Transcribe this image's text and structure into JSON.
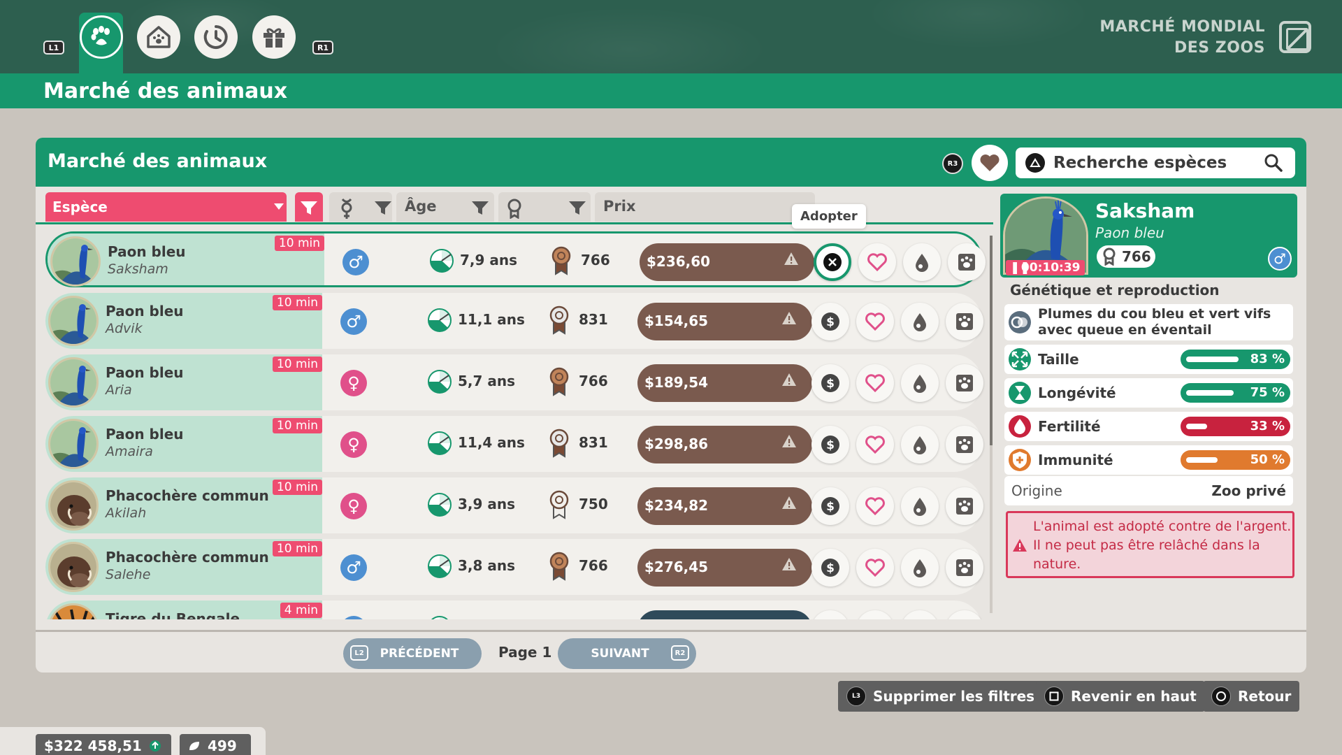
{
  "header": {
    "shoulder_left": "L1",
    "shoulder_right": "R1",
    "brand_line1": "MARCHÉ MONDIAL",
    "brand_line2": "DES ZOOS",
    "page_title": "Marché des animaux"
  },
  "nav_tabs": [
    {
      "icon": "paw-icon",
      "active": true
    },
    {
      "icon": "animal-house-icon",
      "active": false
    },
    {
      "icon": "clock-icon",
      "active": false
    },
    {
      "icon": "gift-icon",
      "active": false
    }
  ],
  "panel": {
    "title": "Marché des animaux",
    "r3_label": "R3",
    "search_placeholder": "Recherche espèces"
  },
  "columns": {
    "species": "Espèce",
    "age": "Âge",
    "price": "Prix"
  },
  "tooltip": "Adopter",
  "rows": [
    {
      "species": "Paon bleu",
      "name": "Saksham",
      "timer": "10 min",
      "sex": "m",
      "sex_symbol": "♂",
      "age": "7,9 ans",
      "rep": "766",
      "price": "$236,60",
      "selected": true
    },
    {
      "species": "Paon bleu",
      "name": "Advik",
      "timer": "10 min",
      "sex": "m",
      "sex_symbol": "♂",
      "age": "11,1 ans",
      "rep": "831",
      "price": "$154,65",
      "selected": false
    },
    {
      "species": "Paon bleu",
      "name": "Aria",
      "timer": "10 min",
      "sex": "f",
      "sex_symbol": "♀",
      "age": "5,7 ans",
      "rep": "766",
      "price": "$189,54",
      "selected": false
    },
    {
      "species": "Paon bleu",
      "name": "Amaira",
      "timer": "10 min",
      "sex": "f",
      "sex_symbol": "♀",
      "age": "11,4 ans",
      "rep": "831",
      "price": "$298,86",
      "selected": false
    },
    {
      "species": "Phacochère commun",
      "name": "Akilah",
      "timer": "10 min",
      "sex": "f",
      "sex_symbol": "♀",
      "age": "3,9 ans",
      "rep": "750",
      "price": "$234,82",
      "selected": false
    },
    {
      "species": "Phacochère commun",
      "name": "Salehe",
      "timer": "10 min",
      "sex": "m",
      "sex_symbol": "♂",
      "age": "3,8 ans",
      "rep": "766",
      "price": "$276,45",
      "selected": false
    },
    {
      "species": "Tigre du Bengale",
      "name": "",
      "timer": "4 min",
      "sex": "m",
      "sex_symbol": "♂",
      "age": "",
      "rep": "",
      "price": "",
      "selected": false
    }
  ],
  "pagination": {
    "prev_pad": "L2",
    "prev_label": "PRÉCÉDENT",
    "page_label": "Page 1",
    "next_label": "SUIVANT",
    "next_pad": "R2"
  },
  "detail": {
    "name": "Saksham",
    "species": "Paon bleu",
    "rep": "766",
    "sex_symbol": "♂",
    "timer": "00:10:39",
    "section_title": "Génétique et reproduction",
    "trait": "Plumes du cou bleu et vert vifs avec queue en éventail",
    "stats": [
      {
        "label": "Taille",
        "value": "83 %",
        "level": 0.83,
        "color": "#17976d",
        "icon": "size-arrows-icon"
      },
      {
        "label": "Longévité",
        "value": "75 %",
        "level": 0.75,
        "color": "#17976d",
        "icon": "hourglass-icon"
      },
      {
        "label": "Fertilité",
        "value": "33 %",
        "level": 0.33,
        "color": "#c8223e",
        "icon": "fertility-drop-icon"
      },
      {
        "label": "Immunité",
        "value": "50 %",
        "level": 0.5,
        "color": "#e07a2e",
        "icon": "shield-cross-icon"
      }
    ],
    "origin_label": "Origine",
    "origin_value": "Zoo privé",
    "alert": "L'animal est adopté contre de l'argent. Il ne peut pas être relâché dans la nature."
  },
  "bottom_actions": {
    "clear_filters": "Supprimer les filtres",
    "clear_pad": "L3",
    "back_to_top": "Revenir en haut",
    "back": "Retour"
  },
  "footer": {
    "money": "$322 458,51",
    "conservation": "499"
  },
  "colors": {
    "accent_green": "#17976d",
    "pink": "#ee4c70",
    "price_brown": "#7a5a4e"
  }
}
